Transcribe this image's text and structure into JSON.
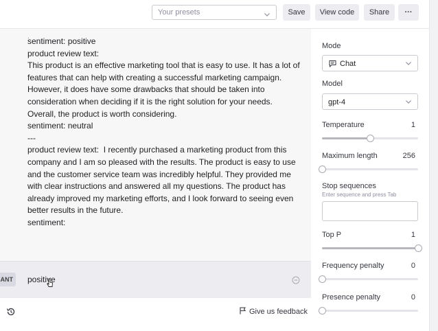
{
  "toolbar": {
    "presets_placeholder": "Your presets",
    "save_label": "Save",
    "view_code_label": "View code",
    "share_label": "Share",
    "more_label": "···"
  },
  "prompt": {
    "leading_dot": ".",
    "text": "sentiment: positive\nproduct review text:\nThis product is an effective marketing tool that is easy to use. It has a lot of features that can help with creating a successful marketing campaign. However, it does have some drawbacks that should be taken into consideration when deciding if it is the right solution for your needs. Overall, the product is worth considering.\nsentiment: neutral\n---\nproduct review text:  I recently purchased a marketing product from this company and I am so pleased with the results. The product is easy to use and the customer service team was incredibly helpful. They provided me with clear instructions and answered all my questions. The product has already improved my marketing efforts, and I look forward to seeing even better results in the future.\nsentiment:"
  },
  "completion": {
    "role_tag": "ANT",
    "text": "positive"
  },
  "footer": {
    "feedback_label": "Give us feedback"
  },
  "panel": {
    "mode": {
      "label": "Mode",
      "value": "Chat"
    },
    "model": {
      "label": "Model",
      "value": "gpt-4"
    },
    "temperature": {
      "label": "Temperature",
      "value": "1",
      "fraction": 0.5
    },
    "max_length": {
      "label": "Maximum length",
      "value": "256",
      "fraction": 0.0
    },
    "stop_sequences": {
      "label": "Stop sequences",
      "hint": "Enter sequence and press Tab"
    },
    "top_p": {
      "label": "Top P",
      "value": "1",
      "fraction": 1.0
    },
    "frequency_penalty": {
      "label": "Frequency penalty",
      "value": "0",
      "fraction": 0.0
    },
    "presence_penalty": {
      "label": "Presence penalty",
      "value": "0",
      "fraction": 0.0
    }
  },
  "icons": [
    "chevron-down-icon",
    "chat-icon",
    "remove-icon",
    "history-icon",
    "flag-icon",
    "cursor-icon"
  ],
  "colors": {
    "page_bg": "#f7f7f8",
    "completion_bg": "#ececf1",
    "button_bg": "#ececf1"
  }
}
